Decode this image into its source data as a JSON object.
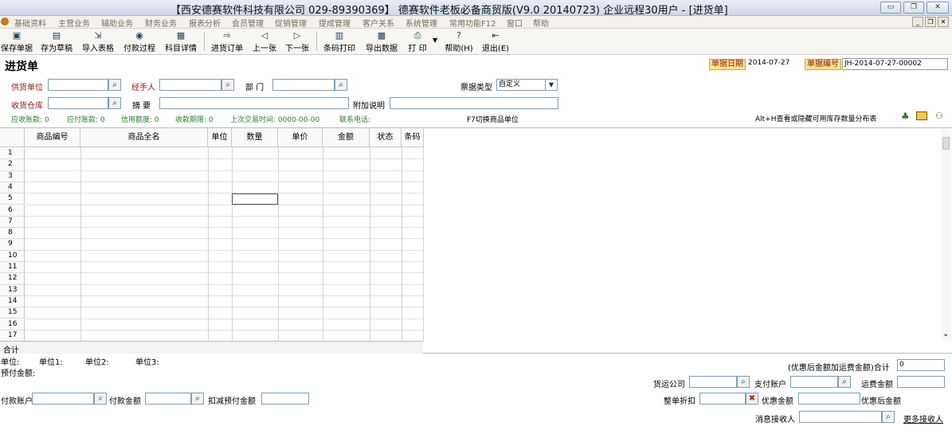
{
  "window": {
    "title": "【西安德赛软件科技有限公司 029-89390369】 德赛软件老板必备商贸版(V9.0 20140723) 企业远程30用户 - [进货单]",
    "minimize": "▭",
    "restore": "❐",
    "close": "✕"
  },
  "menu": [
    "基础资料",
    "主营业务",
    "辅助业务",
    "财务业务",
    "报表分析",
    "会员管理",
    "促销管理",
    "提成管理",
    "客户关系",
    "系统管理",
    "常用功能F12",
    "窗口",
    "帮助"
  ],
  "mdi": {
    "minimize": "_",
    "restore": "❐",
    "close": "✕"
  },
  "toolbar": [
    "保存单据",
    "存为草稿",
    "导入表格",
    "付款过程",
    "科目详情",
    "进货订单",
    "上一张",
    "下一张",
    "条码打印",
    "导出数据",
    "打 印",
    "帮助(H)",
    "退出(E)"
  ],
  "toolbar_icons": [
    "save-icon",
    "draft-icon",
    "import-icon",
    "payment-icon",
    "account-icon",
    "order-icon",
    "prev-icon",
    "next-icon",
    "barcode-icon",
    "export-icon",
    "print-icon",
    "help-icon",
    "exit-icon"
  ],
  "form": {
    "title": "进货单",
    "date_label": "单据日期",
    "date_value": "2014-07-27",
    "no_label": "单据编号",
    "no_value": "JH-2014-07-27-00002",
    "supplier_label": "供货单位",
    "handler_label": "经手人",
    "dept_label": "部  门",
    "invoice_type_label": "票据类型",
    "invoice_type_value": "自定义",
    "warehouse_label": "收货仓库",
    "summary_label": "摘  要",
    "note_label": "附加说明",
    "receivable": "应收账款: 0",
    "payable": "应付账款: 0",
    "credit": "信用额度: 0",
    "term": "收款期限: 0",
    "last_trade": "上次交易时间: 0000-00-00",
    "phone": "联系电话:",
    "f7_hint": "F7切换商品单位",
    "alt_hint": "Alt+H查看或隐藏可用库存数量分布表"
  },
  "grid": {
    "columns": [
      "商品编号",
      "商品全名",
      "单位",
      "数量",
      "单价",
      "金额",
      "状态",
      "条码"
    ],
    "rows": [
      "1",
      "2",
      "3",
      "4",
      "5",
      "6",
      "7",
      "8",
      "9",
      "10",
      "11",
      "12",
      "13",
      "14",
      "15",
      "16",
      "17"
    ],
    "total_label": "合计"
  },
  "footer": {
    "unit": "单位:",
    "unit1": "单位1:",
    "unit2": "单位2:",
    "unit3": "单位3:",
    "prepaid": "预付金额:",
    "discount_total_label": "(优惠后金额加运费金额)合计",
    "discount_total_value": "0",
    "shipping_company": "货运公司",
    "pay_account": "支付账户",
    "freight": "运费金额",
    "payment_account": "付款账户",
    "payment_amount": "付款金额",
    "deduct_prepaid": "扣减预付金额",
    "whole_discount": "整单折扣",
    "discount_amount": "优惠金额",
    "after_discount": "优惠后金额",
    "msg_receiver": "消息接收人",
    "more_receivers": "更多接收人"
  }
}
